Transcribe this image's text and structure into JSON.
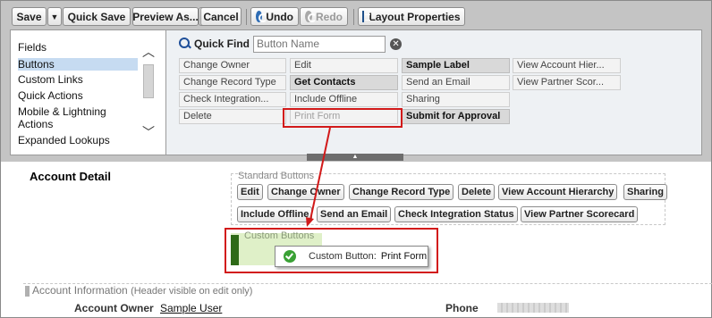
{
  "toolbar": {
    "save": "Save",
    "save_dropdown": "▼",
    "quick_save": "Quick Save",
    "preview_as": "Preview As...",
    "preview_dropdown": "▼",
    "cancel": "Cancel",
    "undo": "Undo",
    "redo": "Redo",
    "layout_properties": "Layout Properties"
  },
  "categories": [
    "Fields",
    "Buttons",
    "Custom Links",
    "Quick Actions",
    "Mobile & Lightning Actions",
    "Expanded Lookups"
  ],
  "quick_find": {
    "label": "Quick Find",
    "placeholder": "Button Name"
  },
  "palette_items": {
    "col1": [
      "Change Owner",
      "Change Record Type",
      "Check Integration...",
      "Delete"
    ],
    "col2": [
      "Edit",
      "Get Contacts",
      "Include Offline",
      "Print Form"
    ],
    "col3": [
      "Sample Label",
      "Send an Email",
      "Sharing",
      "Submit for Approval"
    ],
    "col4": [
      "View Account Hier...",
      "View Partner Scor..."
    ]
  },
  "detail": {
    "title": "Account Detail",
    "standard_title": "Standard Buttons",
    "standard_row1": [
      "Edit",
      "Change Owner",
      "Change Record Type",
      "Delete",
      "View Account Hierarchy",
      "Sharing"
    ],
    "standard_row2": [
      "Include Offline",
      "Send an Email",
      "Check Integration Status",
      "View Partner Scorecard"
    ],
    "custom_title": "Custom Buttons",
    "tip_prefix": "Custom Button:",
    "tip_name": "Print Form"
  },
  "section": {
    "title": "Account Information",
    "note": "(Header visible on edit only)",
    "owner_label": "Account Owner",
    "owner_value": "Sample User",
    "phone_label": "Phone"
  },
  "colors": {
    "highlight_red": "#d21a1a",
    "custom_zone_green": "#dff0c8",
    "selected_category": "#c6dbf1"
  }
}
